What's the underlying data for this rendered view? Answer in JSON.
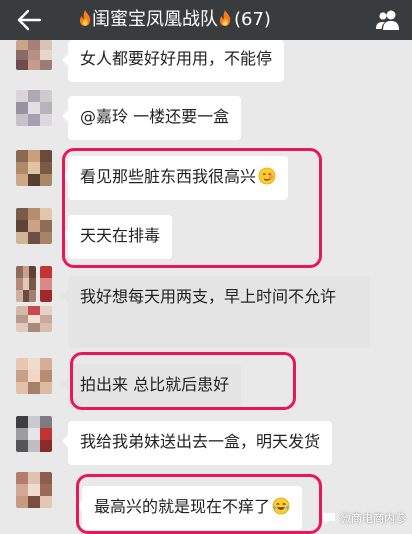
{
  "header": {
    "title": "闺蜜宝凤凰战队",
    "count": "(67)",
    "back_icon": "back-arrow-icon",
    "fire_icon": "fire-icon",
    "group_icon": "group-members-icon",
    "background": "#383c3f"
  },
  "messages": [
    {
      "text": "女人都要好好用用，不能停"
    },
    {
      "text": "@嘉玲 一楼还要一盒"
    },
    {
      "text": "看见那些脏东西我很高兴",
      "emoji": "smirk-emoji-icon"
    },
    {
      "text": "天天在排毒"
    },
    {
      "text": "我好想每天用两支，早上时间不允许"
    },
    {
      "text": "拍出来  总比就后患好"
    },
    {
      "text": "我给我弟妹送出去一盒，明天发货"
    },
    {
      "text": "最高兴的就是现在不痒了",
      "emoji": "tears-of-joy-emoji-icon"
    }
  ],
  "highlight_color": "#e8175d",
  "watermark": "微商电商内参"
}
